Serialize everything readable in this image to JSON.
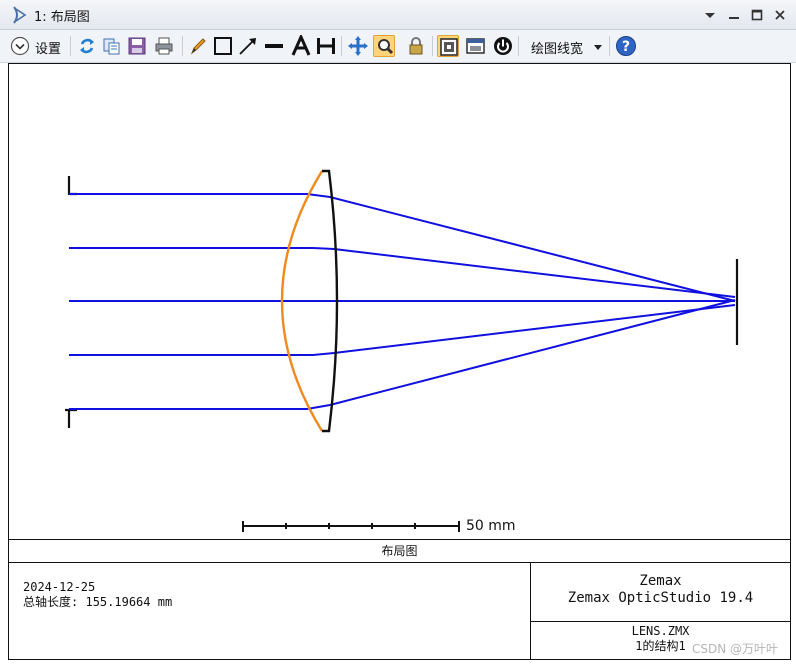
{
  "window": {
    "title": "1: 布局图",
    "icon": "lens-icon",
    "controls": [
      "dropdown-arrow-icon",
      "minimize-icon",
      "maximize-icon",
      "close-icon"
    ]
  },
  "toolbar": {
    "settings_label": "设置",
    "line_width_label": "绘图线宽",
    "icons": [
      "settings-chevron-icon",
      "refresh-icon",
      "copy-icon",
      "save-icon",
      "print-icon",
      "pencil-icon",
      "rectangle-icon",
      "arrow-icon",
      "line-icon",
      "text-icon",
      "dimension-icon",
      "pan-icon",
      "zoom-icon",
      "lock-icon",
      "fit-icon",
      "window-icon",
      "power-icon",
      "help-icon"
    ]
  },
  "plot": {
    "scale_bar_label": "50 mm",
    "caption": "布局图",
    "colors": {
      "rays": "#1010e0",
      "lens_front": "#f08a1e",
      "lens_back": "#111111"
    }
  },
  "info": {
    "date": "2024-12-25",
    "total_length_label": "总轴长度:",
    "total_length_value": "155.19664 mm",
    "company": "Zemax",
    "product": "Zemax OpticStudio 19.4",
    "file_name": "LENS.ZMX",
    "configuration": "1的结构1"
  },
  "watermark": "CSDN @万叶叶"
}
